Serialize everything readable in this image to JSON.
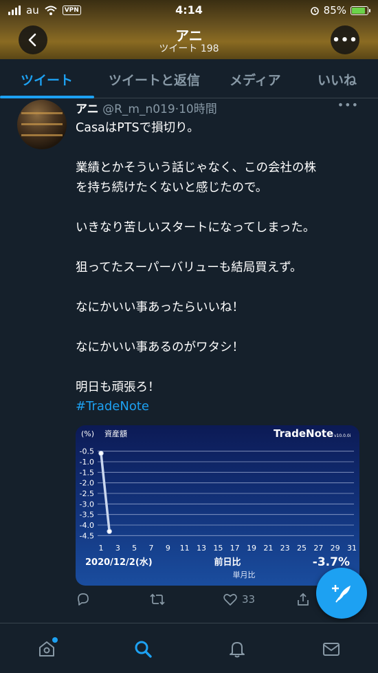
{
  "status_bar": {
    "carrier": "au",
    "vpn": "VPN",
    "time": "4:14",
    "battery": "85%",
    "battery_level": 0.85
  },
  "header": {
    "title": "アニ",
    "subtitle": "ツイート 198"
  },
  "tabs": [
    {
      "label": "ツイート",
      "active": true
    },
    {
      "label": "ツイートと返信",
      "active": false
    },
    {
      "label": "メディア",
      "active": false
    },
    {
      "label": "いいね",
      "active": false
    }
  ],
  "tweet": {
    "name": "アニ",
    "handle": "@R_m_n019",
    "time": "·10時間",
    "lines": [
      [
        "CasaはPTSで損切り。"
      ],
      [
        "業績とかそういう話じゃなく、この会社の株",
        "を持ち続けたくないと感じたので。"
      ],
      [
        "いきなり苦しいスタートになってしまった。"
      ],
      [
        "狙ってたスーパーバリューも結局買えず。"
      ],
      [
        "なにかいい事あったらいいね！"
      ],
      [
        "なにかいい事あるのがワタシ！"
      ],
      [
        "明日も頑張ろ！"
      ]
    ],
    "hashtag": "#TradeNote",
    "actions": {
      "reply": "",
      "retweet": "",
      "like": "33",
      "share": ""
    }
  },
  "chart_data": {
    "type": "line",
    "brand": "TradeNote",
    "version": "v10.0.0i",
    "unit_label": "(%)",
    "ylabel": "資産額",
    "yticks": [
      "-0.5",
      "-1.0",
      "-1.5",
      "-2.0",
      "-2.5",
      "-3.0",
      "-3.5",
      "-4.0",
      "-4.5"
    ],
    "ylim": [
      -4.75,
      -0.25
    ],
    "xticks": [
      "1",
      "3",
      "5",
      "7",
      "9",
      "11",
      "13",
      "15",
      "17",
      "19",
      "21",
      "23",
      "25",
      "27",
      "29",
      "31"
    ],
    "xlim": [
      1,
      31
    ],
    "series": [
      {
        "values": [
          {
            "x": 1,
            "y": -0.6
          },
          {
            "x": 2,
            "y": -4.3
          }
        ]
      }
    ],
    "date": "2020/12/2(水)",
    "compare_label": "前日比",
    "compare_value": "-3.7%",
    "sub_label": "単月比",
    "colors": {
      "line": "#c9d6ee",
      "grid": "#b9c6e6",
      "value": "#ffffff"
    }
  },
  "bottom_nav": [
    {
      "icon": "home-icon",
      "active": false,
      "badge": true
    },
    {
      "icon": "search-icon",
      "active": true,
      "badge": false
    },
    {
      "icon": "bell-icon",
      "active": false,
      "badge": false
    },
    {
      "icon": "mail-icon",
      "active": false,
      "badge": false
    }
  ],
  "colors": {
    "accent": "#1da1f2",
    "background": "#15202b",
    "muted": "#8899a6"
  }
}
